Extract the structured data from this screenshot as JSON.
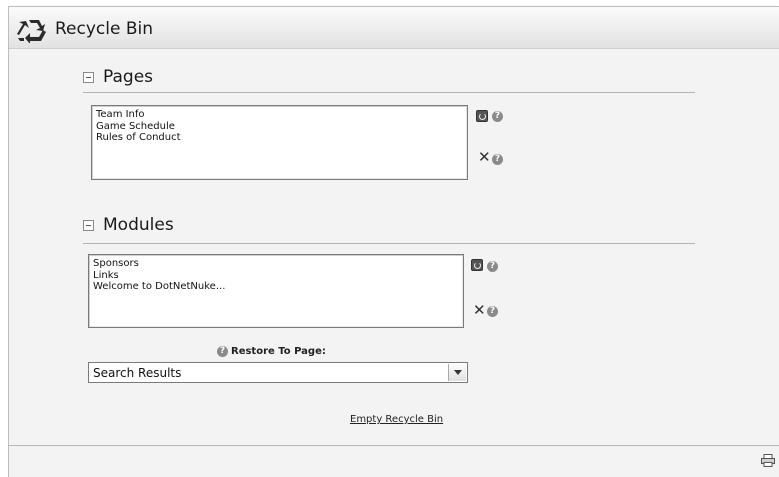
{
  "header": {
    "title": "Recycle Bin",
    "icon": "recycle-icon"
  },
  "pages": {
    "section_title": "Pages",
    "items": [
      "Team Info",
      "Game Schedule",
      "Rules of Conduct"
    ]
  },
  "modules": {
    "section_title": "Modules",
    "items": [
      "Sponsors",
      "Links",
      "Welcome to DotNetNuke..."
    ]
  },
  "restore": {
    "label": "Restore To Page:",
    "selected": "Search Results"
  },
  "actions": {
    "empty_label": "Empty Recycle Bin"
  },
  "icons": {
    "help_glyph": "?",
    "delete_glyph": "✕"
  },
  "colors": {
    "background": "#f3f3f3",
    "header": "#ececec",
    "rule": "#b5b5b5"
  }
}
